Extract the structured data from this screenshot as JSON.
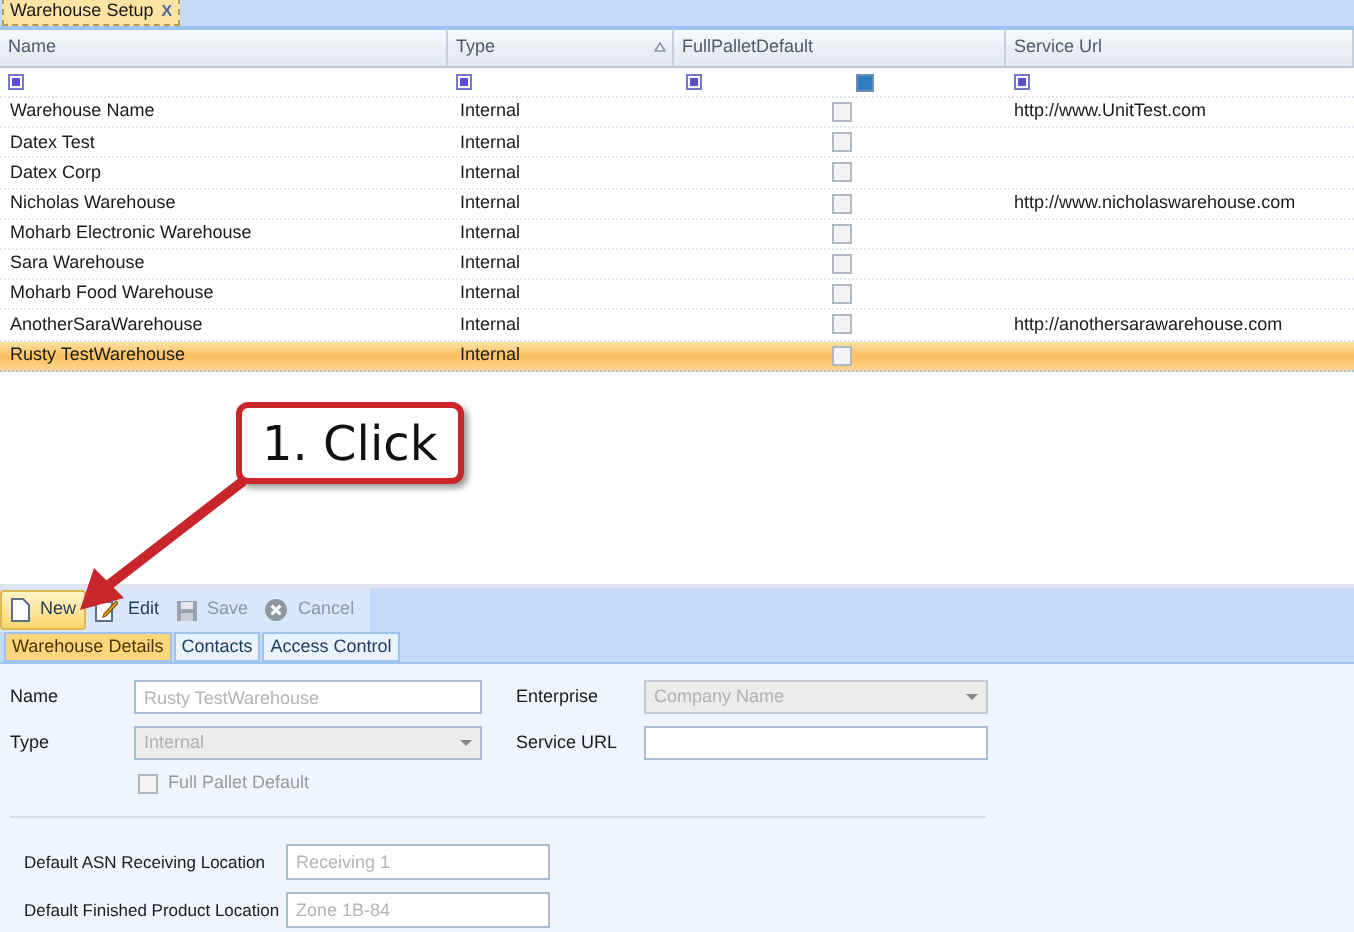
{
  "document_tab": {
    "title": "Warehouse Setup",
    "close": "X"
  },
  "grid": {
    "columns": [
      {
        "label": "Name",
        "sorted": false
      },
      {
        "label": "Type",
        "sorted": true
      },
      {
        "label": "FullPalletDefault",
        "sorted": false
      },
      {
        "label": "Service Url",
        "sorted": false
      }
    ],
    "rows": [
      {
        "name": "Warehouse Name",
        "type": "Internal",
        "full_pallet_default": false,
        "service_url": "http://www.UnitTest.com",
        "selected": false
      },
      {
        "name": "Datex Test",
        "type": "Internal",
        "full_pallet_default": false,
        "selected": false
      },
      {
        "name": "Datex Corp",
        "type": "Internal",
        "full_pallet_default": false,
        "selected": false
      },
      {
        "name": "Nicholas Warehouse",
        "type": "Internal",
        "full_pallet_default": false,
        "service_url": "http://www.nicholaswarehouse.com",
        "selected": false
      },
      {
        "name": "Moharb Electronic Warehouse",
        "type": "Internal",
        "full_pallet_default": false,
        "selected": false
      },
      {
        "name": "Sara Warehouse",
        "type": "Internal",
        "full_pallet_default": false,
        "selected": false
      },
      {
        "name": "Moharb Food Warehouse",
        "type": "Internal",
        "full_pallet_default": false,
        "selected": false
      },
      {
        "name": "AnotherSaraWarehouse",
        "type": "Internal",
        "full_pallet_default": false,
        "service_url": "http://anothersarawarehouse.com",
        "selected": false
      },
      {
        "name": "Rusty TestWarehouse",
        "type": "Internal",
        "full_pallet_default": false,
        "selected": true
      }
    ]
  },
  "toolbar": [
    {
      "label": "New",
      "kind": "new",
      "disabled": false,
      "highlighted": true
    },
    {
      "label": "Edit",
      "kind": "edit",
      "disabled": false,
      "highlighted": false
    },
    {
      "label": "Save",
      "kind": "save",
      "disabled": true,
      "highlighted": false
    },
    {
      "label": "Cancel",
      "kind": "cancel",
      "disabled": true,
      "highlighted": false
    }
  ],
  "detail_tabs": [
    {
      "label": "Warehouse Details",
      "selected": true
    },
    {
      "label": "Contacts",
      "selected": false
    },
    {
      "label": "Access Control",
      "selected": false
    }
  ],
  "form": {
    "name": {
      "label": "Name",
      "placeholder": "Rusty TestWarehouse"
    },
    "type": {
      "label": "Type",
      "placeholder": "Internal"
    },
    "full_pallet_default": {
      "label": "Full Pallet Default",
      "checked": false
    },
    "enterprise": {
      "label": "Enterprise",
      "placeholder": "Company Name"
    },
    "service_url": {
      "label": "Service URL"
    },
    "asn_location": {
      "label": "Default ASN Receiving Location",
      "placeholder": "Receiving 1"
    },
    "finished_location": {
      "label": "Default Finished Product Location",
      "placeholder": "Zone 1B-84"
    }
  },
  "callout": {
    "text": "1. Click"
  }
}
